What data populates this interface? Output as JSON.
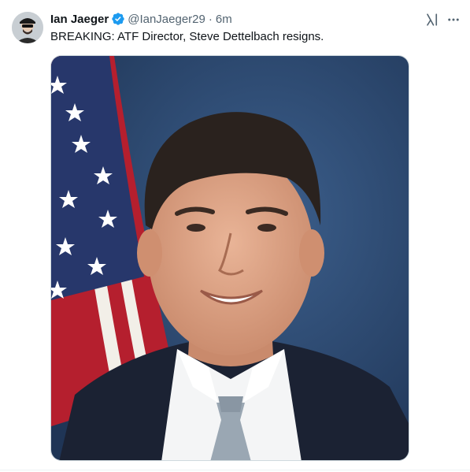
{
  "tweet": {
    "author_name": "Ian Jaeger",
    "author_handle": "@IanJaeger29",
    "separator": "·",
    "timestamp": "6m",
    "text": "BREAKING: ATF Director, Steve Dettelbach resigns.",
    "verified": true
  },
  "icons": {
    "avatar": "avatar",
    "verified": "verified-badge-icon",
    "grok": "grok-icon",
    "more": "more-horizontal-icon"
  },
  "colors": {
    "verified_blue": "#1d9bf0",
    "secondary_text": "#536471",
    "primary_text": "#0f1419"
  }
}
